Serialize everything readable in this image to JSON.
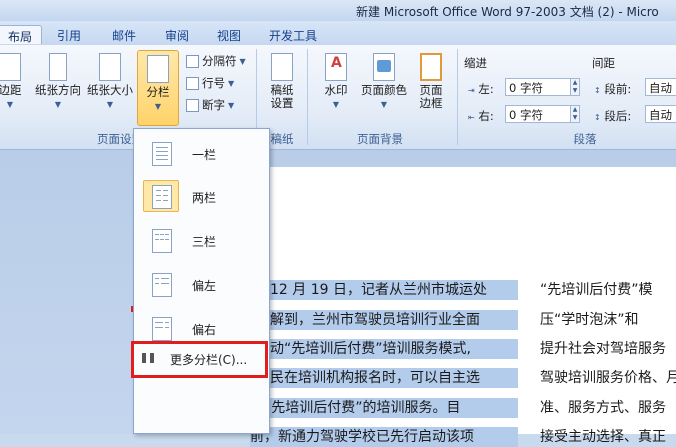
{
  "window": {
    "title": "新建 Microsoft Office Word 97-2003 文档 (2) - Micro"
  },
  "tabs": [
    "布局",
    "引用",
    "邮件",
    "审阅",
    "视图",
    "开发工具"
  ],
  "ribbon": {
    "page_setup": {
      "margins": "边距",
      "orientation": "纸张方向",
      "size": "纸张大小",
      "columns": "分栏",
      "breaks": "分隔符",
      "line_numbers": "行号",
      "hyphenation": "断字",
      "group_label": "页面设置"
    },
    "manuscript": {
      "button": "稿纸",
      "button2": "设置",
      "group_label": "稿纸"
    },
    "page_background": {
      "watermark": "水印",
      "page_color": "页面颜色",
      "page_borders_1": "页面",
      "page_borders_2": "边框",
      "group_label": "页面背景"
    },
    "paragraph": {
      "indent_label": "缩进",
      "left_label": "左:",
      "left_value": "0 字符",
      "right_label": "右:",
      "right_value": "0 字符",
      "spacing_label": "间距",
      "before_label": "段前:",
      "before_value": "自动",
      "after_label": "段后:",
      "after_value": "自动",
      "group_label": "段落"
    }
  },
  "columns_menu": {
    "items": [
      {
        "label": "一栏",
        "selected": false
      },
      {
        "label": "两栏",
        "selected": true
      },
      {
        "label": "三栏",
        "selected": false
      },
      {
        "label": "偏左",
        "selected": false
      },
      {
        "label": "偏右",
        "selected": false
      }
    ],
    "more": "更多分栏(C)..."
  },
  "document": {
    "col1": [
      "12 月 19 日，记者从兰州市城运处",
      "解到，兰州市驾驶员培训行业全面",
      "动“先培训后付费”培训服务模式,",
      "民在培训机构报名时，可以自主选",
      "择“先培训后付费”的培训服务。目",
      "前，新通力驾驶学校已先行启动该项"
    ],
    "col2": [
      "“先培训后付费”模",
      "压“学时泡沫”和",
      "提升社会对驾培服务",
      "驾驶培训服务价格、月",
      "准、服务方式、服务",
      "接受主动选择、真正"
    ]
  },
  "colors": {
    "highlight": "#b4ccec",
    "callout": "#e11d1d",
    "selected_menu": "#ffe8a8"
  }
}
